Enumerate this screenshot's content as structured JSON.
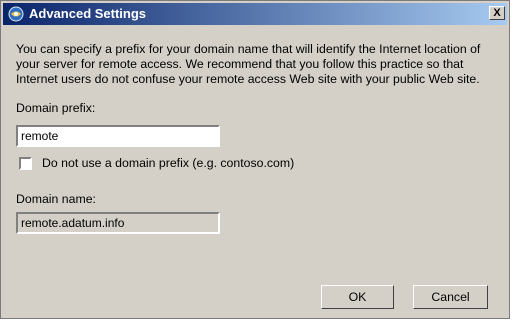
{
  "window": {
    "title": "Advanced Settings",
    "close_label": "X"
  },
  "description": "You can specify a prefix for your domain name that will identify the Internet location of your server for remote access. We recommend that you follow this practice so that Internet users do not confuse your remote access Web site with your public Web site.",
  "prefix": {
    "label": "Domain prefix:",
    "value": "remote"
  },
  "no_prefix": {
    "label": "Do not use a domain prefix (e.g. contoso.com)",
    "checked": false
  },
  "domain": {
    "label": "Domain name:",
    "value": "remote.adatum.info"
  },
  "buttons": {
    "ok": "OK",
    "cancel": "Cancel"
  }
}
